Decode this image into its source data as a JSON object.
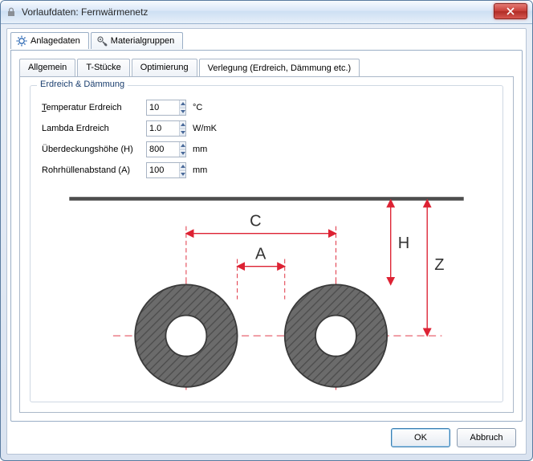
{
  "window": {
    "title": "Vorlaufdaten: Fernwärmenetz"
  },
  "outer_tabs": {
    "anlagedaten": "Anlagedaten",
    "materialgruppen": "Materialgruppen"
  },
  "inner_tabs": {
    "allgemein": "Allgemein",
    "tstuecke": "T-Stücke",
    "optimierung": "Optimierung",
    "verlegung": "Verlegung (Erdreich, Dämmung etc.)"
  },
  "group": {
    "title": "Erdreich & Dämmung"
  },
  "fields": {
    "temperatur": {
      "label_pre": "T",
      "label_rest": "emperatur Erdreich",
      "value": "10",
      "unit": "°C"
    },
    "lambda": {
      "label": "Lambda Erdreich",
      "value": "1.0",
      "unit": "W/mK"
    },
    "ueberdeck": {
      "label": "Überdeckungshöhe (H)",
      "value": "800",
      "unit": "mm"
    },
    "abstand": {
      "label": "Rohrhüllenabstand (A)",
      "value": "100",
      "unit": "mm"
    }
  },
  "diagram_labels": {
    "C": "C",
    "A": "A",
    "H": "H",
    "Z": "Z"
  },
  "buttons": {
    "ok": "OK",
    "cancel": "Abbruch"
  },
  "icons": {
    "lock": "lock-icon",
    "gear_blue": "settings-icon",
    "gear_spanner": "material-icon",
    "close": "close-icon",
    "up": "▲",
    "down": "▼"
  }
}
